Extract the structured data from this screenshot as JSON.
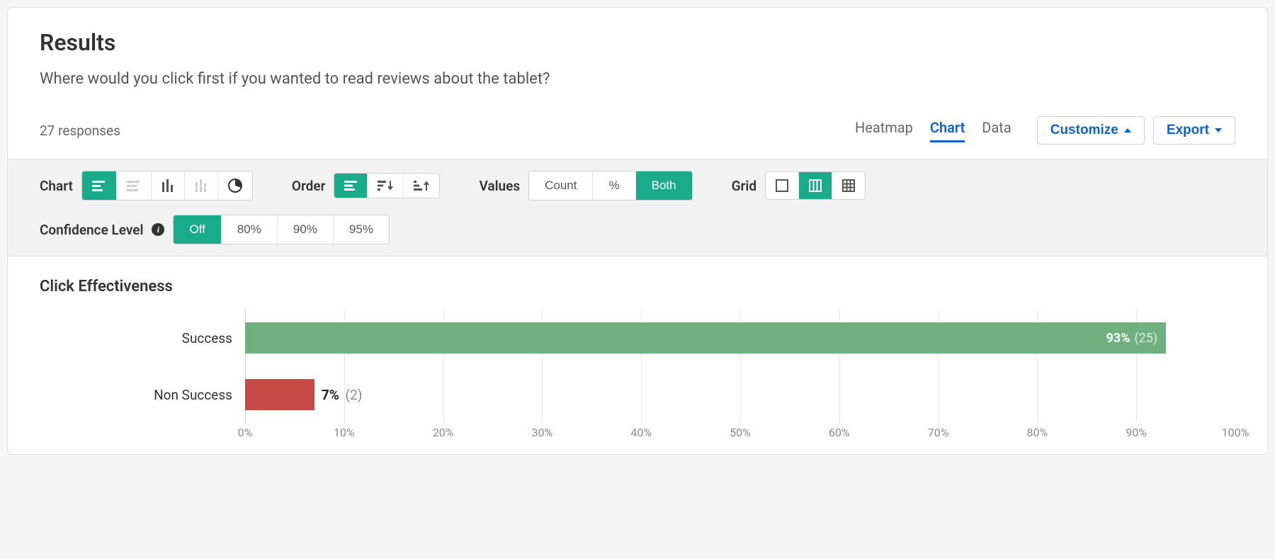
{
  "header": {
    "title": "Results",
    "question": "Where would you click first if you wanted to read reviews about the tablet?",
    "responses_label": "27 responses"
  },
  "view_tabs": {
    "heatmap": "Heatmap",
    "chart": "Chart",
    "data": "Data",
    "active": "chart"
  },
  "buttons": {
    "customize": "Customize",
    "export": "Export"
  },
  "options": {
    "chart_label": "Chart",
    "order_label": "Order",
    "values_label": "Values",
    "values_count": "Count",
    "values_percent": "%",
    "values_both": "Both",
    "grid_label": "Grid",
    "confidence_label": "Confidence Level",
    "confidence_off": "Off",
    "confidence_80": "80%",
    "confidence_90": "90%",
    "confidence_95": "95%"
  },
  "chart_heading": "Click Effectiveness",
  "chart_data": {
    "type": "bar",
    "orientation": "horizontal",
    "title": "Click Effectiveness",
    "xlabel": "",
    "ylabel": "",
    "xlim": [
      0,
      100
    ],
    "x_ticks": [
      "0%",
      "10%",
      "20%",
      "30%",
      "40%",
      "50%",
      "60%",
      "70%",
      "80%",
      "90%",
      "100%"
    ],
    "categories": [
      "Success",
      "Non Success"
    ],
    "series": [
      {
        "name": "Percent",
        "values": [
          93,
          7
        ]
      },
      {
        "name": "Count",
        "values": [
          25,
          2
        ]
      }
    ],
    "colors": [
      "#6fb07f",
      "#c64a46"
    ],
    "value_labels": [
      {
        "percent": "93%",
        "count": "(25)"
      },
      {
        "percent": "7%",
        "count": "(2)"
      }
    ]
  }
}
